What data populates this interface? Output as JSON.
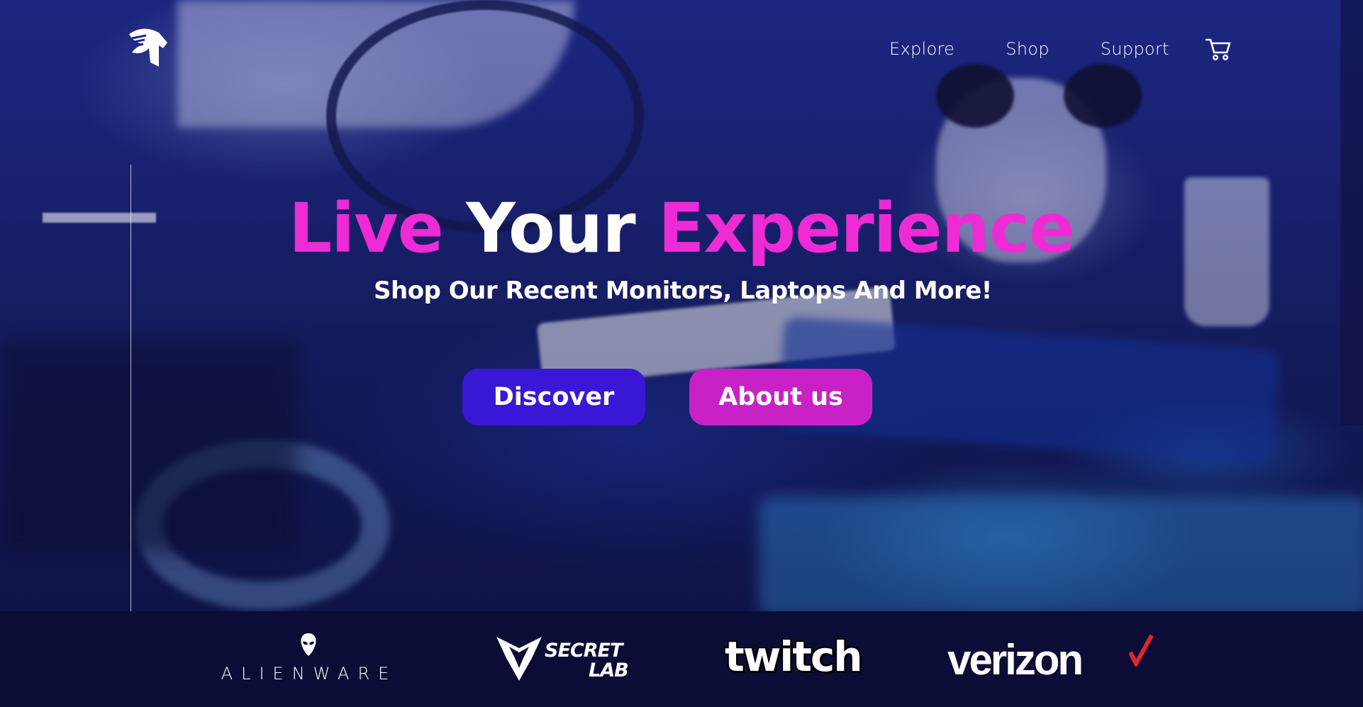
{
  "nav": {
    "items": [
      {
        "label": "Explore"
      },
      {
        "label": "Shop"
      },
      {
        "label": "Support"
      }
    ],
    "cart_icon": "cart-icon"
  },
  "hero": {
    "headline": {
      "word1": "Live",
      "word2": "Your",
      "word3": "Experience"
    },
    "subheadline": "Shop Our Recent Monitors, Laptops And More!",
    "buttons": {
      "discover": "Discover",
      "about": "About us"
    }
  },
  "partners": {
    "alienware": "ALIENWARE",
    "secretlab_line1": "SECRET",
    "secretlab_line2": "LAB",
    "twitch": "twitch",
    "verizon": "verizon"
  },
  "colors": {
    "accent_pink": "#ef2bd6",
    "button_blue": "#3a17d6",
    "button_pink": "#c822c6",
    "partner_bar": "#0c0d36"
  }
}
